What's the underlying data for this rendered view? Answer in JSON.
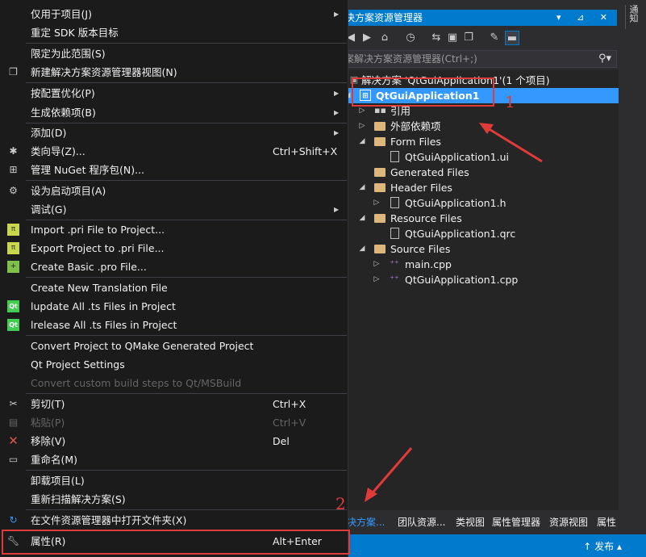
{
  "solution_explorer": {
    "title": "决方案资源管理器",
    "title_controls": "▾ ⊿ ✕",
    "search_placeholder": "案解决方案资源管理器(Ctrl+;)",
    "tree": [
      {
        "label": "解决方案 'QtGuiApplication1'(1 个项目)"
      },
      {
        "label": "QtGuiApplication1"
      },
      {
        "label": "引用"
      },
      {
        "label": "外部依赖项"
      },
      {
        "label": "Form Files"
      },
      {
        "label": "QtGuiApplication1.ui"
      },
      {
        "label": "Generated Files"
      },
      {
        "label": "Header Files"
      },
      {
        "label": "QtGuiApplication1.h"
      },
      {
        "label": "Resource Files"
      },
      {
        "label": "QtGuiApplication1.qrc"
      },
      {
        "label": "Source Files"
      },
      {
        "label": "main.cpp"
      },
      {
        "label": "QtGuiApplication1.cpp"
      }
    ],
    "tabs": [
      "决方案...",
      "团队资源...",
      "类视图",
      "属性管理器",
      "资源视图",
      "属性"
    ],
    "status_publish": "发布"
  },
  "side_strip": {
    "label": "通知"
  },
  "annotations": {
    "one": "1",
    "two": "2"
  },
  "menu": {
    "items": [
      {
        "label": "仅用于项目(J)"
      },
      {
        "label": "重定 SDK 版本目标"
      },
      {
        "label": "限定为此范围(S)"
      },
      {
        "label": "新建解决方案资源管理器视图(N)"
      },
      {
        "label": "按配置优化(P)"
      },
      {
        "label": "生成依赖项(B)"
      },
      {
        "label": "添加(D)"
      },
      {
        "label": "类向导(Z)...",
        "key": "Ctrl+Shift+X"
      },
      {
        "label": "管理 NuGet 程序包(N)..."
      },
      {
        "label": "设为启动项目(A)"
      },
      {
        "label": "调试(G)"
      },
      {
        "label": "Import .pri File to Project..."
      },
      {
        "label": "Export Project to .pri File..."
      },
      {
        "label": "Create Basic .pro File..."
      },
      {
        "label": "Create New Translation File"
      },
      {
        "label": "lupdate All .ts Files in Project"
      },
      {
        "label": "lrelease All .ts Files in Project"
      },
      {
        "label": "Convert Project to QMake Generated Project"
      },
      {
        "label": "Qt Project Settings"
      },
      {
        "label": "Convert custom build steps to Qt/MSBuild"
      },
      {
        "label": "剪切(T)",
        "key": "Ctrl+X"
      },
      {
        "label": "粘贴(P)",
        "key": "Ctrl+V"
      },
      {
        "label": "移除(V)",
        "key": "Del"
      },
      {
        "label": "重命名(M)"
      },
      {
        "label": "卸载项目(L)"
      },
      {
        "label": "重新扫描解决方案(S)"
      },
      {
        "label": "在文件资源管理器中打开文件夹(X)"
      },
      {
        "label": "属性(R)",
        "key": "Alt+Enter"
      }
    ]
  },
  "colors": {
    "accent": "#007acc",
    "selection": "#3399ff",
    "annotation": "#e03b3b"
  }
}
